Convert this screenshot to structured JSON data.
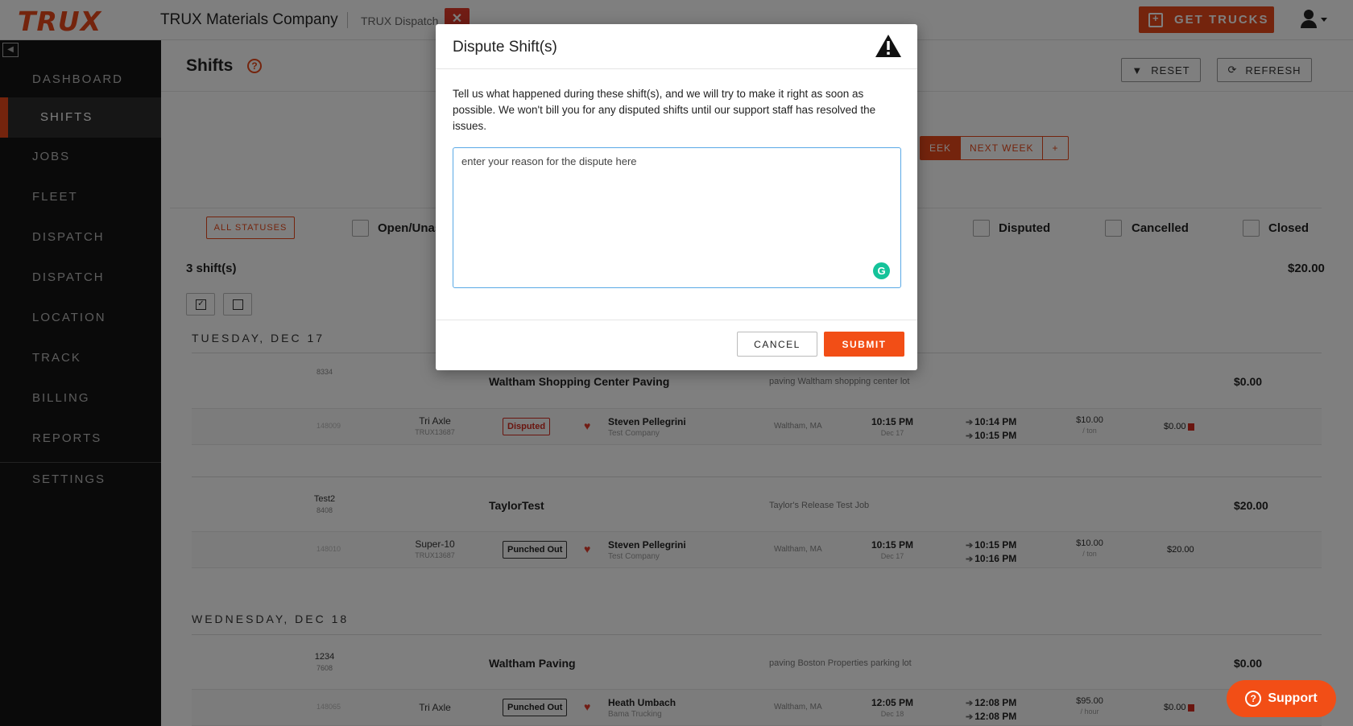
{
  "header": {
    "logo": "TRUX",
    "company": "TRUX Materials Company",
    "app_name": "TRUX Dispatch",
    "get_trucks_label": "GET TRUCKS"
  },
  "sidebar": {
    "items": [
      {
        "label": "DASHBOARD"
      },
      {
        "label": "SHIFTS"
      },
      {
        "label": "JOBS"
      },
      {
        "label": "FLEET"
      },
      {
        "label": "DISPATCH"
      },
      {
        "label": "DISPATCH"
      },
      {
        "label": "LOCATION"
      },
      {
        "label": "TRACK"
      },
      {
        "label": "BILLING"
      },
      {
        "label": "REPORTS"
      },
      {
        "label": "SETTINGS"
      }
    ]
  },
  "page": {
    "title": "Shifts",
    "reset_label": "RESET",
    "refresh_label": "REFRESH",
    "week_partial": "EEK",
    "next_week": "NEXT WEEK",
    "add": "+",
    "all_statuses": "ALL STATUSES",
    "filters": {
      "open": "Open/Unas",
      "disputed": "Disputed",
      "cancelled": "Cancelled",
      "closed": "Closed"
    },
    "shift_count": "3 shift(s)",
    "total": "$20.00"
  },
  "days": [
    {
      "label": "TUESDAY, DEC 17",
      "jobs": [
        {
          "code": "",
          "sub": "8334",
          "name": "Waltham Shopping Center Paving",
          "desc": "paving Waltham shopping center lot",
          "amount": "$0.00",
          "shift": {
            "id": "148009",
            "truck": "Tri Axle",
            "truck_id": "TRUX13687",
            "status": "Disputed",
            "driver": "Steven Pellegrini",
            "company": "Test Company",
            "location": "Waltham, MA",
            "time": "10:15 PM",
            "date": "Dec 17",
            "punch_in": "10:14 PM",
            "punch_out": "10:15 PM",
            "rate": "$10.00",
            "rate_unit": "/ ton",
            "amount": "$0.00"
          }
        },
        {
          "code": "Test2",
          "sub": "8408",
          "name": "TaylorTest",
          "desc": "Taylor's Release Test Job",
          "amount": "$20.00",
          "shift": {
            "id": "148010",
            "truck": "Super-10",
            "truck_id": "TRUX13687",
            "status": "Punched Out",
            "driver": "Steven Pellegrini",
            "company": "Test Company",
            "location": "Waltham, MA",
            "time": "10:15 PM",
            "date": "Dec 17",
            "punch_in": "10:15 PM",
            "punch_out": "10:16 PM",
            "rate": "$10.00",
            "rate_unit": "/ ton",
            "amount": "$20.00"
          }
        }
      ]
    },
    {
      "label": "WEDNESDAY, DEC 18",
      "jobs": [
        {
          "code": "1234",
          "sub": "7608",
          "name": "Waltham Paving",
          "desc": "paving Boston Properties parking lot",
          "amount": "$0.00",
          "shift": {
            "id": "148065",
            "truck": "Tri Axle",
            "truck_id": "",
            "status": "Punched Out",
            "driver": "Heath Umbach",
            "company": "Bama Trucking",
            "location": "Waltham, MA",
            "time": "12:05 PM",
            "date": "Dec 18",
            "punch_in": "12:08 PM",
            "punch_out": "12:08 PM",
            "rate": "$95.00",
            "rate_unit": "/ hour",
            "amount": "$0.00"
          }
        }
      ]
    }
  ],
  "modal": {
    "title": "Dispute Shift(s)",
    "description": "Tell us what happened during these shift(s), and we will try to make it right as soon as possible. We won't bill you for any disputed shifts until our support staff has resolved the issues.",
    "textarea_placeholder": "enter your reason for the dispute here",
    "textarea_value": "",
    "cancel_label": "CANCEL",
    "submit_label": "SUBMIT"
  },
  "support": {
    "label": "Support"
  },
  "colors": {
    "accent": "#e8491a",
    "disputed": "#d42b1f",
    "grammarly": "#15c39a"
  }
}
